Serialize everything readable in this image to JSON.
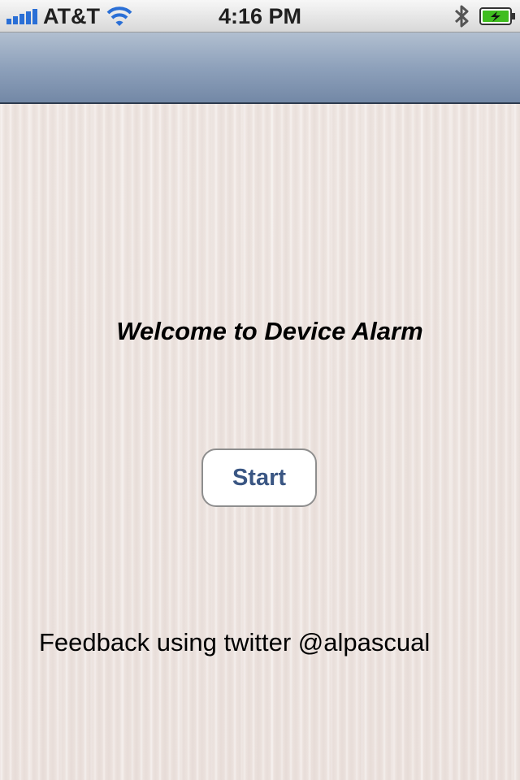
{
  "status_bar": {
    "carrier": "AT&T",
    "time": "4:16 PM",
    "battery_color": "#3fbd1f"
  },
  "nav_bar": {
    "title": ""
  },
  "main": {
    "welcome_text": "Welcome to Device Alarm",
    "start_label": "Start",
    "feedback_text": "Feedback using twitter @alpascual"
  },
  "colors": {
    "button_text": "#3a5683",
    "nav_bar": "#8ea1bb"
  }
}
